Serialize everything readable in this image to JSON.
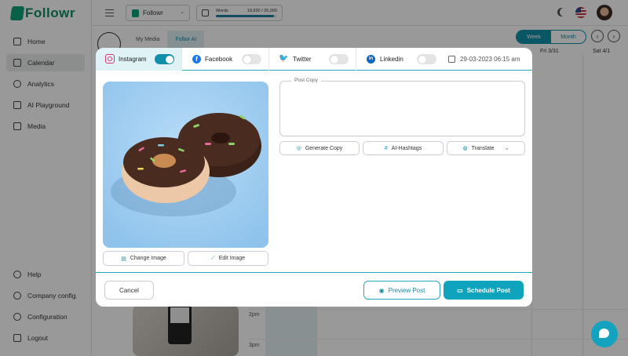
{
  "app": {
    "brand": "Followr"
  },
  "sidebar": {
    "items": [
      {
        "label": "Home",
        "icon": "home-icon"
      },
      {
        "label": "Calendar",
        "icon": "calendar-icon",
        "active": true
      },
      {
        "label": "Analytics",
        "icon": "analytics-icon"
      },
      {
        "label": "AI Playground",
        "icon": "ai-icon"
      },
      {
        "label": "Media",
        "icon": "media-icon"
      }
    ],
    "bottom_items": [
      {
        "label": "Help",
        "icon": "help-icon"
      },
      {
        "label": "Company config.",
        "icon": "gear-icon"
      },
      {
        "label": "Configuration",
        "icon": "settings-icon"
      },
      {
        "label": "Logout",
        "icon": "logout-icon"
      }
    ]
  },
  "topbar": {
    "workspace": "Followr",
    "words_label": "Words",
    "words_value": "18,930 / 20,000",
    "words_fraction": 0.9465
  },
  "calendar": {
    "tabs": [
      "My Media",
      "Follwr AI"
    ],
    "views": [
      "Week",
      "Month"
    ],
    "active_view": "Week",
    "day_headers": [
      "Fri 3/31",
      "Sat 4/1"
    ],
    "times": [
      "2pm",
      "3pm"
    ],
    "prev": "‹",
    "next": "›"
  },
  "modal": {
    "tabs": [
      {
        "label": "Instagram",
        "icon": "instagram-icon",
        "enabled": true
      },
      {
        "label": "Facebook",
        "icon": "facebook-icon",
        "enabled": false
      },
      {
        "label": "Twitter",
        "icon": "twitter-icon",
        "enabled": false
      },
      {
        "label": "Linkedin",
        "icon": "linkedin-icon",
        "enabled": false
      }
    ],
    "datetime": "29-03-2023 06:15 am",
    "image_buttons": {
      "change": "Change Image",
      "edit": "Edit Image"
    },
    "post_copy": {
      "label": "Post Copy",
      "value": ""
    },
    "actions": {
      "generate": "Generate Copy",
      "hashtags": "AI-Hashtags",
      "translate": "Translate"
    },
    "footer": {
      "cancel": "Cancel",
      "preview": "Preview Post",
      "schedule": "Schedule Post"
    }
  },
  "colors": {
    "accent": "#0f8fa9",
    "brand": "#10a07a"
  }
}
